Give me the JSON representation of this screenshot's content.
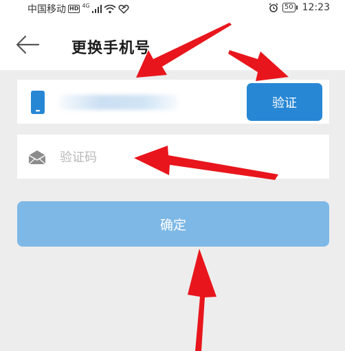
{
  "status_bar": {
    "carrier": "中国移动",
    "hd_badge": "HD",
    "network_badge": "4G",
    "battery": "50",
    "time": "12:23"
  },
  "header": {
    "title": "更换手机号"
  },
  "phone_row": {
    "verify_label": "验证"
  },
  "code_row": {
    "placeholder": "验证码"
  },
  "confirm_label": "确定",
  "colors": {
    "accent_blue": "#2787d4",
    "confirm_blue": "#7eb8e6",
    "annotation_red": "#e8161c",
    "background": "#ededed"
  },
  "icons": [
    "back-arrow-icon",
    "phone-icon",
    "envelope-icon",
    "signal-icon",
    "wifi-icon",
    "alarm-icon",
    "battery-icon"
  ]
}
